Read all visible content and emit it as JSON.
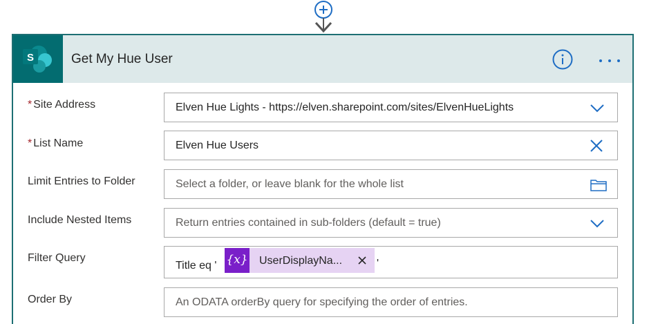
{
  "card": {
    "title": "Get My Hue User",
    "logo_letter": "S",
    "brand_color": "#036c70",
    "header_bg": "#dde9ea",
    "info_icon": "info-circle-icon",
    "more_icon": "ellipsis-icon",
    "connector_icon": "add-step-icon"
  },
  "fields": {
    "site_address": {
      "label": "Site Address",
      "required_mark": "*",
      "value": "Elven Hue Lights - https://elven.sharepoint.com/sites/ElvenHueLights",
      "icon": "chevron-down-icon"
    },
    "list_name": {
      "label": "List Name",
      "required_mark": "*",
      "value": "Elven Hue Users",
      "icon": "clear-icon"
    },
    "limit_folder": {
      "label": "Limit Entries to Folder",
      "placeholder": "Select a folder, or leave blank for the whole list",
      "icon": "folder-icon"
    },
    "nested_items": {
      "label": "Include Nested Items",
      "placeholder": "Return entries contained in sub-folders (default = true)",
      "icon": "chevron-down-icon"
    },
    "filter_query": {
      "label": "Filter Query",
      "prefix": "Title eq '",
      "token_symbol": "{x}",
      "token_label": "UserDisplayNa...",
      "token_color": "#7a1fc9",
      "suffix": "'"
    },
    "order_by": {
      "label": "Order By",
      "placeholder": "An ODATA orderBy query for specifying the order of entries."
    }
  }
}
